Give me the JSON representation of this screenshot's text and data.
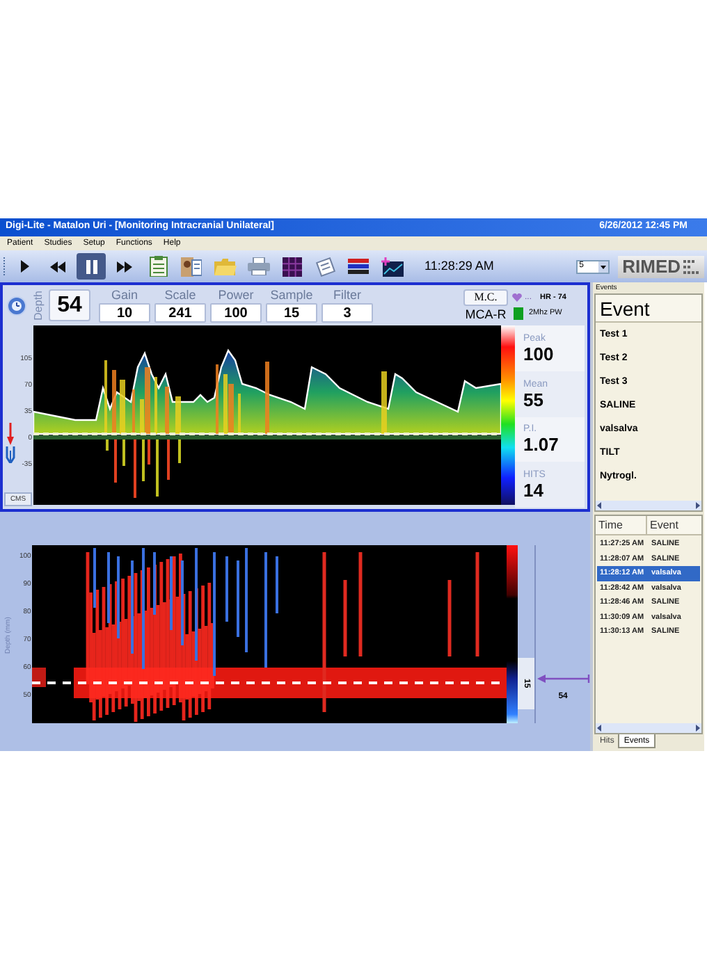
{
  "window": {
    "title": "Digi-Lite - Matalon Uri - [Monitoring Intracranial Unilateral]",
    "datetime": "6/26/2012 12:45 PM"
  },
  "menu": [
    "Patient",
    "Studies",
    "Setup",
    "Functions",
    "Help"
  ],
  "toolbar": {
    "buttons": [
      {
        "kind": "play",
        "selected": false
      },
      {
        "kind": "rewind",
        "selected": false
      },
      {
        "kind": "pause",
        "selected": true
      },
      {
        "kind": "forward",
        "selected": false
      },
      {
        "kind": "clipboard",
        "selected": false
      },
      {
        "kind": "report",
        "selected": false
      },
      {
        "kind": "folder",
        "selected": false
      },
      {
        "kind": "printer",
        "selected": false
      },
      {
        "kind": "grid",
        "selected": false
      },
      {
        "kind": "notes",
        "selected": false
      },
      {
        "kind": "bars",
        "selected": false
      },
      {
        "kind": "chart",
        "selected": false
      }
    ],
    "time": "11:28:29 AM",
    "select_value": "5",
    "logo": "RIMED"
  },
  "controls": {
    "depth_label": "Depth",
    "depth": "54",
    "params": [
      {
        "label": "Gain",
        "value": "10"
      },
      {
        "label": "Scale",
        "value": "241"
      },
      {
        "label": "Power",
        "value": "100"
      },
      {
        "label": "Sample",
        "value": "15"
      },
      {
        "label": "Filter",
        "value": "3"
      }
    ],
    "mc_button": "M.C.",
    "vessel": "MCA-R",
    "heart_suffix": "...",
    "heart_rate": "HR - 74",
    "probe": "2Mhz PW"
  },
  "spectrum": {
    "y_labels": [
      "105",
      "70",
      "35",
      "0",
      "-35"
    ],
    "cms_button": "CMS"
  },
  "stats": [
    {
      "label": "Peak",
      "value": "100"
    },
    {
      "label": "Mean",
      "value": "55"
    },
    {
      "label": "P.I.",
      "value": "1.07"
    },
    {
      "label": "HITS",
      "value": "14"
    }
  ],
  "mmode": {
    "ylabel": "Depth (mm)",
    "y_labels": [
      "100",
      "90",
      "80",
      "70",
      "60",
      "50"
    ],
    "gate": "15",
    "depth_marker": "54"
  },
  "events_panel": {
    "header": "Events",
    "title": "Event",
    "items": [
      "Test 1",
      "Test 2",
      "Test 3",
      "SALINE",
      "valsalva",
      "TILT",
      "Nytrogl."
    ],
    "log_columns": [
      "Time",
      "Event"
    ],
    "log_rows": [
      {
        "time": "11:27:25 AM",
        "event": "SALINE",
        "selected": false
      },
      {
        "time": "11:28:07 AM",
        "event": "SALINE",
        "selected": false
      },
      {
        "time": "11:28:12 AM",
        "event": "valsalva",
        "selected": true
      },
      {
        "time": "11:28:42 AM",
        "event": "valsalva",
        "selected": false
      },
      {
        "time": "11:28:46 AM",
        "event": "SALINE",
        "selected": false
      },
      {
        "time": "11:30:09 AM",
        "event": "valsalva",
        "selected": false
      },
      {
        "time": "11:30:13 AM",
        "event": "SALINE",
        "selected": false
      }
    ],
    "tabs": [
      {
        "label": "Hits",
        "selected": false
      },
      {
        "label": "Events",
        "selected": true
      }
    ]
  }
}
